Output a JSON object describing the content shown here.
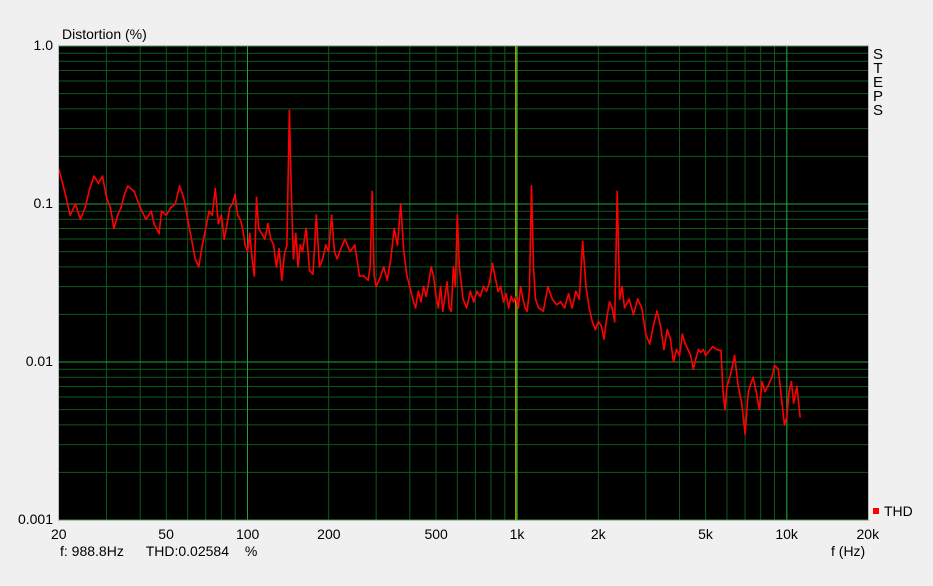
{
  "chart_data": {
    "type": "line",
    "ylabel": "Distortion (%)",
    "xlabel": "f (Hz)",
    "x_scale": "log",
    "y_scale": "log",
    "xlim": [
      20,
      20000
    ],
    "ylim": [
      0.001,
      1.0
    ],
    "x_ticks": [
      {
        "v": 20,
        "label": "20"
      },
      {
        "v": 50,
        "label": "50"
      },
      {
        "v": 100,
        "label": "100"
      },
      {
        "v": 200,
        "label": "200"
      },
      {
        "v": 500,
        "label": "500"
      },
      {
        "v": 1000,
        "label": "1k"
      },
      {
        "v": 2000,
        "label": "2k"
      },
      {
        "v": 5000,
        "label": "5k"
      },
      {
        "v": 10000,
        "label": "10k"
      },
      {
        "v": 20000,
        "label": "20k"
      }
    ],
    "y_ticks": [
      {
        "v": 1.0,
        "label": "1.0"
      },
      {
        "v": 0.1,
        "label": "0.1"
      },
      {
        "v": 0.01,
        "label": "0.01"
      },
      {
        "v": 0.001,
        "label": "0.001"
      }
    ],
    "grid": true,
    "legend_placement": "bottom-right",
    "cursor_x": 988.8,
    "series": [
      {
        "name": "THD",
        "color": "#ff0000",
        "points": [
          [
            20,
            0.165
          ],
          [
            21,
            0.12
          ],
          [
            22,
            0.085
          ],
          [
            23,
            0.1
          ],
          [
            24,
            0.08
          ],
          [
            25,
            0.095
          ],
          [
            26,
            0.125
          ],
          [
            27,
            0.15
          ],
          [
            28,
            0.135
          ],
          [
            29,
            0.15
          ],
          [
            30,
            0.11
          ],
          [
            31,
            0.095
          ],
          [
            32,
            0.07
          ],
          [
            33,
            0.085
          ],
          [
            34,
            0.095
          ],
          [
            35,
            0.115
          ],
          [
            36,
            0.13
          ],
          [
            38,
            0.12
          ],
          [
            40,
            0.095
          ],
          [
            42,
            0.08
          ],
          [
            44,
            0.09
          ],
          [
            45,
            0.075
          ],
          [
            47,
            0.065
          ],
          [
            48,
            0.09
          ],
          [
            50,
            0.085
          ],
          [
            52,
            0.095
          ],
          [
            54,
            0.1
          ],
          [
            56,
            0.13
          ],
          [
            58,
            0.11
          ],
          [
            60,
            0.08
          ],
          [
            62,
            0.06
          ],
          [
            64,
            0.045
          ],
          [
            66,
            0.04
          ],
          [
            68,
            0.055
          ],
          [
            70,
            0.07
          ],
          [
            72,
            0.09
          ],
          [
            74,
            0.085
          ],
          [
            76,
            0.125
          ],
          [
            78,
            0.075
          ],
          [
            80,
            0.085
          ],
          [
            82,
            0.06
          ],
          [
            84,
            0.075
          ],
          [
            86,
            0.095
          ],
          [
            88,
            0.1
          ],
          [
            90,
            0.115
          ],
          [
            92,
            0.085
          ],
          [
            94,
            0.08
          ],
          [
            96,
            0.07
          ],
          [
            98,
            0.055
          ],
          [
            100,
            0.05
          ],
          [
            102,
            0.065
          ],
          [
            104,
            0.045
          ],
          [
            106,
            0.035
          ],
          [
            108,
            0.11
          ],
          [
            110,
            0.07
          ],
          [
            113,
            0.065
          ],
          [
            116,
            0.06
          ],
          [
            119,
            0.075
          ],
          [
            122,
            0.06
          ],
          [
            125,
            0.055
          ],
          [
            128,
            0.04
          ],
          [
            131,
            0.052
          ],
          [
            134,
            0.033
          ],
          [
            137,
            0.048
          ],
          [
            140,
            0.055
          ],
          [
            143,
            0.39
          ],
          [
            145,
            0.14
          ],
          [
            148,
            0.045
          ],
          [
            151,
            0.065
          ],
          [
            154,
            0.04
          ],
          [
            157,
            0.055
          ],
          [
            160,
            0.05
          ],
          [
            165,
            0.07
          ],
          [
            170,
            0.038
          ],
          [
            175,
            0.036
          ],
          [
            180,
            0.085
          ],
          [
            185,
            0.04
          ],
          [
            190,
            0.045
          ],
          [
            195,
            0.055
          ],
          [
            200,
            0.05
          ],
          [
            205,
            0.085
          ],
          [
            210,
            0.05
          ],
          [
            215,
            0.045
          ],
          [
            220,
            0.05
          ],
          [
            230,
            0.06
          ],
          [
            240,
            0.05
          ],
          [
            250,
            0.055
          ],
          [
            260,
            0.035
          ],
          [
            270,
            0.035
          ],
          [
            280,
            0.033
          ],
          [
            285,
            0.04
          ],
          [
            290,
            0.12
          ],
          [
            295,
            0.035
          ],
          [
            300,
            0.03
          ],
          [
            310,
            0.034
          ],
          [
            320,
            0.04
          ],
          [
            330,
            0.033
          ],
          [
            340,
            0.045
          ],
          [
            350,
            0.07
          ],
          [
            360,
            0.055
          ],
          [
            370,
            0.1
          ],
          [
            380,
            0.05
          ],
          [
            390,
            0.035
          ],
          [
            400,
            0.03
          ],
          [
            410,
            0.025
          ],
          [
            420,
            0.022
          ],
          [
            430,
            0.028
          ],
          [
            440,
            0.024
          ],
          [
            450,
            0.03
          ],
          [
            460,
            0.026
          ],
          [
            470,
            0.032
          ],
          [
            480,
            0.04
          ],
          [
            490,
            0.035
          ],
          [
            500,
            0.026
          ],
          [
            510,
            0.022
          ],
          [
            520,
            0.03
          ],
          [
            530,
            0.021
          ],
          [
            540,
            0.026
          ],
          [
            550,
            0.032
          ],
          [
            560,
            0.022
          ],
          [
            570,
            0.021
          ],
          [
            580,
            0.04
          ],
          [
            590,
            0.03
          ],
          [
            600,
            0.085
          ],
          [
            610,
            0.04
          ],
          [
            620,
            0.032
          ],
          [
            630,
            0.025
          ],
          [
            650,
            0.022
          ],
          [
            670,
            0.028
          ],
          [
            690,
            0.024
          ],
          [
            710,
            0.028
          ],
          [
            730,
            0.026
          ],
          [
            750,
            0.03
          ],
          [
            770,
            0.028
          ],
          [
            790,
            0.032
          ],
          [
            810,
            0.042
          ],
          [
            830,
            0.034
          ],
          [
            850,
            0.028
          ],
          [
            870,
            0.03
          ],
          [
            890,
            0.024
          ],
          [
            910,
            0.027
          ],
          [
            930,
            0.022
          ],
          [
            950,
            0.026
          ],
          [
            970,
            0.024
          ],
          [
            988.8,
            0.02584
          ],
          [
            1010,
            0.022
          ],
          [
            1030,
            0.03
          ],
          [
            1050,
            0.025
          ],
          [
            1070,
            0.022
          ],
          [
            1090,
            0.021
          ],
          [
            1110,
            0.028
          ],
          [
            1130,
            0.13
          ],
          [
            1150,
            0.04
          ],
          [
            1170,
            0.025
          ],
          [
            1200,
            0.022
          ],
          [
            1250,
            0.021
          ],
          [
            1300,
            0.03
          ],
          [
            1350,
            0.025
          ],
          [
            1400,
            0.023
          ],
          [
            1450,
            0.024
          ],
          [
            1500,
            0.022
          ],
          [
            1550,
            0.027
          ],
          [
            1600,
            0.022
          ],
          [
            1650,
            0.028
          ],
          [
            1700,
            0.025
          ],
          [
            1750,
            0.058
          ],
          [
            1800,
            0.03
          ],
          [
            1850,
            0.022
          ],
          [
            1900,
            0.018
          ],
          [
            1950,
            0.016
          ],
          [
            2000,
            0.018
          ],
          [
            2050,
            0.017
          ],
          [
            2100,
            0.014
          ],
          [
            2150,
            0.019
          ],
          [
            2200,
            0.024
          ],
          [
            2250,
            0.022
          ],
          [
            2300,
            0.018
          ],
          [
            2350,
            0.12
          ],
          [
            2400,
            0.025
          ],
          [
            2450,
            0.03
          ],
          [
            2500,
            0.022
          ],
          [
            2600,
            0.025
          ],
          [
            2700,
            0.02
          ],
          [
            2800,
            0.025
          ],
          [
            2900,
            0.022
          ],
          [
            3000,
            0.015
          ],
          [
            3100,
            0.013
          ],
          [
            3200,
            0.017
          ],
          [
            3300,
            0.021
          ],
          [
            3400,
            0.017
          ],
          [
            3500,
            0.012
          ],
          [
            3600,
            0.016
          ],
          [
            3700,
            0.014
          ],
          [
            3800,
            0.01
          ],
          [
            3900,
            0.012
          ],
          [
            4000,
            0.011
          ],
          [
            4100,
            0.015
          ],
          [
            4200,
            0.013
          ],
          [
            4300,
            0.012
          ],
          [
            4400,
            0.011
          ],
          [
            4500,
            0.009
          ],
          [
            4600,
            0.0105
          ],
          [
            4700,
            0.012
          ],
          [
            4800,
            0.0115
          ],
          [
            4900,
            0.012
          ],
          [
            5000,
            0.011
          ],
          [
            5100,
            0.0115
          ],
          [
            5300,
            0.0125
          ],
          [
            5500,
            0.012
          ],
          [
            5700,
            0.0118
          ],
          [
            5800,
            0.0065
          ],
          [
            5900,
            0.005
          ],
          [
            6000,
            0.007
          ],
          [
            6200,
            0.0085
          ],
          [
            6400,
            0.011
          ],
          [
            6600,
            0.007
          ],
          [
            6800,
            0.0055
          ],
          [
            7000,
            0.0035
          ],
          [
            7200,
            0.0065
          ],
          [
            7500,
            0.008
          ],
          [
            7700,
            0.0065
          ],
          [
            7900,
            0.005
          ],
          [
            8100,
            0.0075
          ],
          [
            8300,
            0.0065
          ],
          [
            8500,
            0.007
          ],
          [
            8800,
            0.008
          ],
          [
            9000,
            0.0095
          ],
          [
            9300,
            0.009
          ],
          [
            9600,
            0.0055
          ],
          [
            9800,
            0.004
          ],
          [
            10000,
            0.0045
          ],
          [
            10200,
            0.0065
          ],
          [
            10400,
            0.0075
          ],
          [
            10600,
            0.0055
          ],
          [
            10900,
            0.007
          ],
          [
            11200,
            0.0045
          ]
        ]
      }
    ]
  },
  "side_label": [
    "S",
    "T",
    "E",
    "P",
    "S"
  ],
  "readout": {
    "freq": "f: 988.8Hz",
    "thd": "THD:0.02584",
    "unit": "%"
  },
  "colors": {
    "plot_background": "#000000",
    "major_grid": "#1fa33a",
    "minor_grid": "#0b5a1c",
    "cursor": "#e6e600",
    "frame": "#bdbdbd"
  }
}
